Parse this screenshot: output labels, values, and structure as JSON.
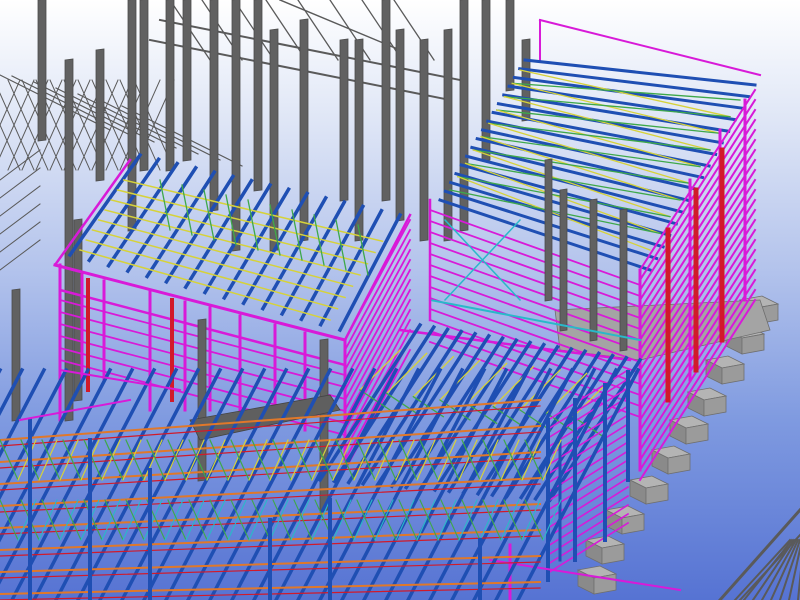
{
  "viewport": {
    "background_top": "#ffffff",
    "background_bottom": "#5673d3"
  },
  "materials": {
    "column": "#616161",
    "column_dark": "#4d4d4d",
    "foundation": "#9b9b9b",
    "truss_gray": "#5a5a5a",
    "purlin": "#1f4fb3",
    "girt": "#d81ad8",
    "brace_yellow": "#d6d23a",
    "brace_green": "#3ea84a",
    "red_member": "#d11a2a",
    "orange_member": "#e0782a",
    "cyan_member": "#29b9c9"
  },
  "model": {
    "structures": [
      "background-gray-steel-frames",
      "left-building-roof-frame",
      "right-building-frame",
      "lower-central-truss-building",
      "lower-left-truss-grid"
    ]
  }
}
